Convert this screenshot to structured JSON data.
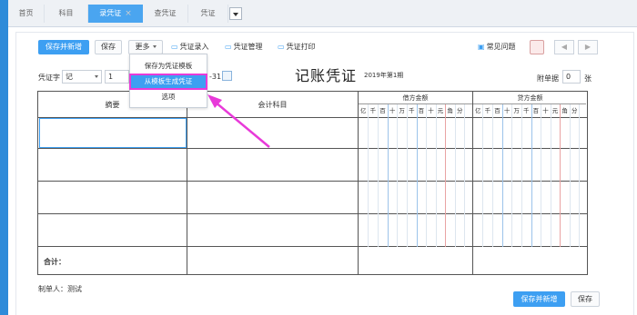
{
  "tabs": [
    {
      "label": "首页"
    },
    {
      "label": "科目"
    },
    {
      "label": "录凭证",
      "close": "×"
    },
    {
      "label": "查凭证"
    },
    {
      "label": "凭证"
    }
  ],
  "toolbar": {
    "save_new": "保存并新增",
    "save": "保存",
    "more": "更多",
    "voucher_entry": "凭证录入",
    "voucher_manage": "凭证管理",
    "voucher_print": "凭证打印",
    "faq": "常见问题",
    "prev": "◀",
    "next": "▶"
  },
  "dropdown": {
    "items": [
      "保存为凭证模板",
      "从模板生成凭证",
      "选项"
    ]
  },
  "form": {
    "voucher_word_label": "凭证字",
    "voucher_word_value": "记",
    "voucher_no": "1",
    "date_tail": "-31",
    "title": "记账凭证",
    "period": "2019年第1期",
    "attachments_label": "附单据",
    "attachments_value": "0",
    "attachments_unit": "张"
  },
  "table": {
    "col_summary": "摘要",
    "col_account": "会计科目",
    "col_debit": "借方金额",
    "col_credit": "贷方金额",
    "digits": [
      "亿",
      "千",
      "百",
      "十",
      "万",
      "千",
      "百",
      "十",
      "元",
      "角",
      "分"
    ],
    "total_label": "合计："
  },
  "footer": {
    "maker": "制单人：测试",
    "save_new": "保存并新增",
    "save": "保存"
  },
  "colors": {
    "primary": "#3d9ff2",
    "highlight_border": "#e83ad9",
    "left_bar": "#2e8bd9"
  }
}
